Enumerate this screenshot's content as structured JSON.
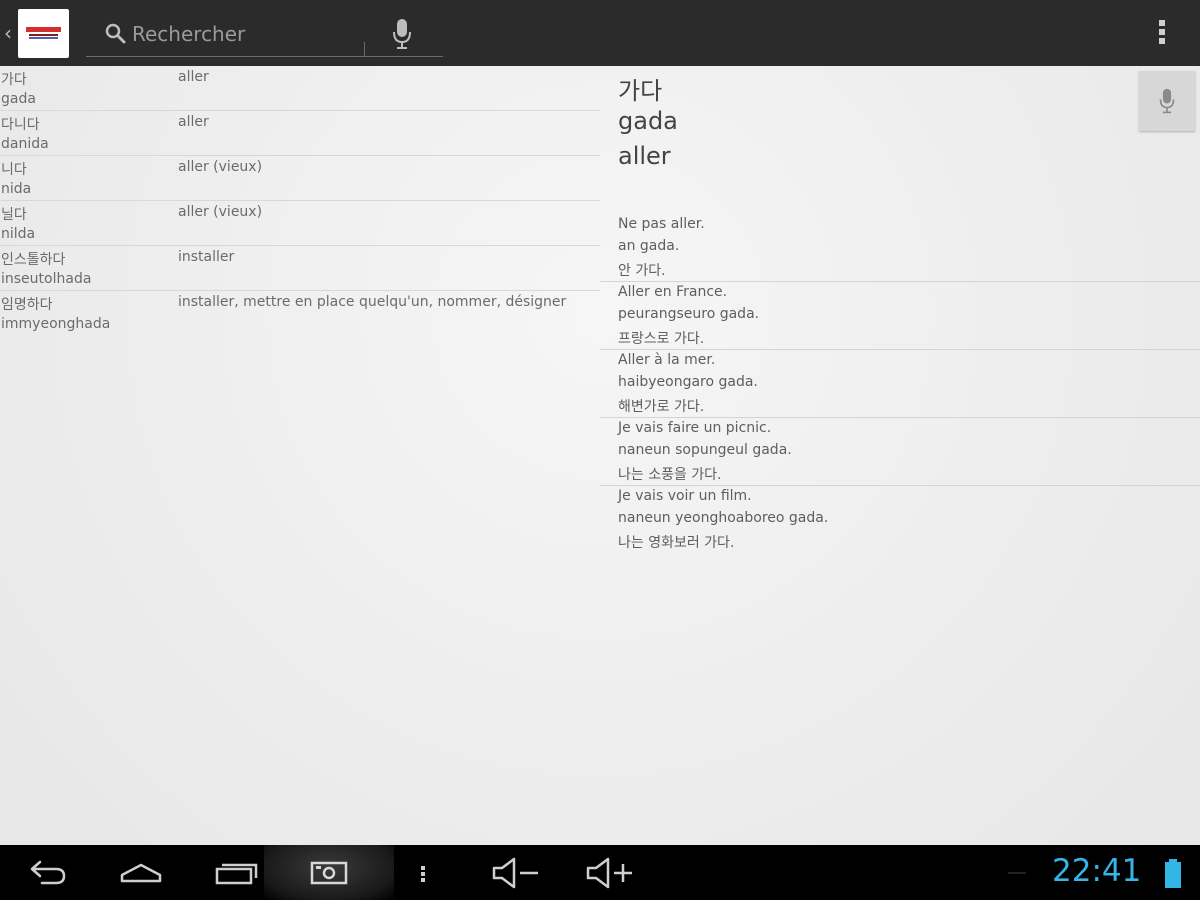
{
  "actionbar": {
    "search_placeholder": "Rechercher"
  },
  "wordlist": [
    {
      "korean": "가다",
      "romanization": "gada",
      "french": "aller"
    },
    {
      "korean": "다니다",
      "romanization": "danida",
      "french": "aller"
    },
    {
      "korean": "니다",
      "romanization": "nida",
      "french": "aller (vieux)"
    },
    {
      "korean": "닐다",
      "romanization": "nilda",
      "french": "aller (vieux)"
    },
    {
      "korean": "인스톨하다",
      "romanization": "inseutolhada",
      "french": "installer"
    },
    {
      "korean": "임명하다",
      "romanization": "immyeonghada",
      "french": "installer, mettre en place quelqu'un, nommer, désigner"
    }
  ],
  "detail": {
    "korean": "가다",
    "romanization": "gada",
    "french": "aller",
    "examples": [
      {
        "french": "Ne pas aller.",
        "romanization": "an gada.",
        "korean": "안 가다."
      },
      {
        "french": "Aller en France.",
        "romanization": "peurangseuro gada.",
        "korean": "프랑스로 가다."
      },
      {
        "french": "Aller à la mer.",
        "romanization": "haibyeongaro gada.",
        "korean": "해변가로 가다."
      },
      {
        "french": "Je vais faire un picnic.",
        "romanization": "naneun sopungeul gada.",
        "korean": "나는 소풍을 가다."
      },
      {
        "french": "Je vais voir un film.",
        "romanization": "naneun yeonghoaboreo gada.",
        "korean": "나는 영화보러 가다."
      }
    ]
  },
  "systembar": {
    "clock": "22:41",
    "accent_color": "#33b5e5"
  },
  "icons": {
    "search": "magnifier-icon",
    "voice": "microphone-icon",
    "menu": "overflow-menu-icon",
    "back": "back-icon",
    "home": "home-icon",
    "recents": "recent-apps-icon",
    "screenshot": "screenshot-icon",
    "volume_down": "volume-down-icon",
    "volume_up": "volume-up-icon",
    "battery": "battery-icon"
  }
}
